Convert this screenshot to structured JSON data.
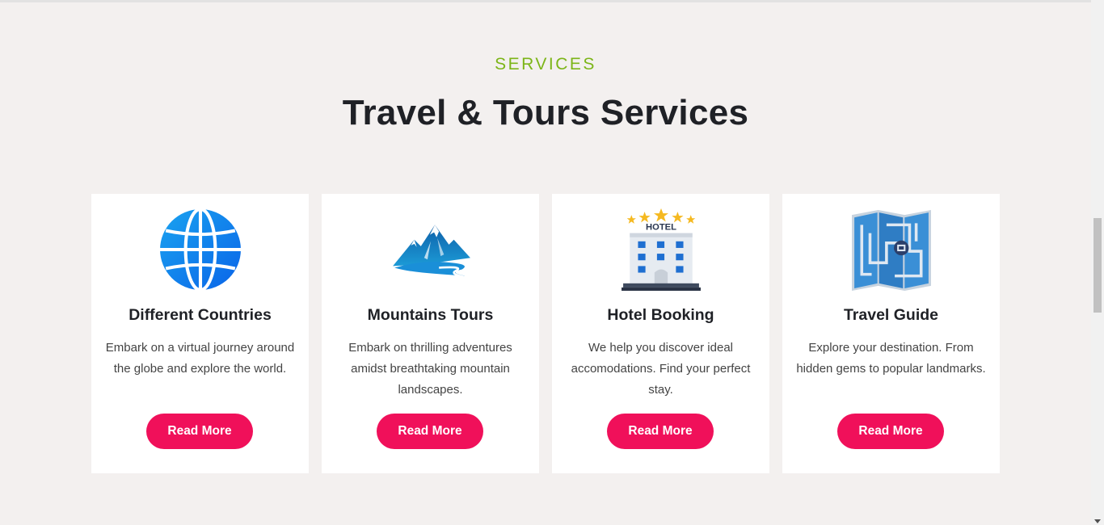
{
  "section": {
    "eyebrow": "SERVICES",
    "title": "Travel & Tours Services"
  },
  "cards": [
    {
      "icon": "globe-icon",
      "title": "Different Countries",
      "description": "Embark on a virtual journey around the globe and explore the world.",
      "button_label": "Read More"
    },
    {
      "icon": "mountain-icon",
      "title": "Mountains Tours",
      "description": "Embark on thrilling adventures amidst breathtaking mountain landscapes.",
      "button_label": "Read More"
    },
    {
      "icon": "hotel-icon",
      "hotel_sign": "HOTEL",
      "title": "Hotel Booking",
      "description": "We help you discover ideal accomodations. Find your perfect stay.",
      "button_label": "Read More"
    },
    {
      "icon": "map-icon",
      "title": "Travel Guide",
      "description": "Explore your destination. From hidden gems to popular landmarks.",
      "button_label": "Read More"
    }
  ],
  "colors": {
    "accent_green": "#7cb518",
    "button_pink": "#f0105a",
    "background": "#f3f0ef"
  }
}
